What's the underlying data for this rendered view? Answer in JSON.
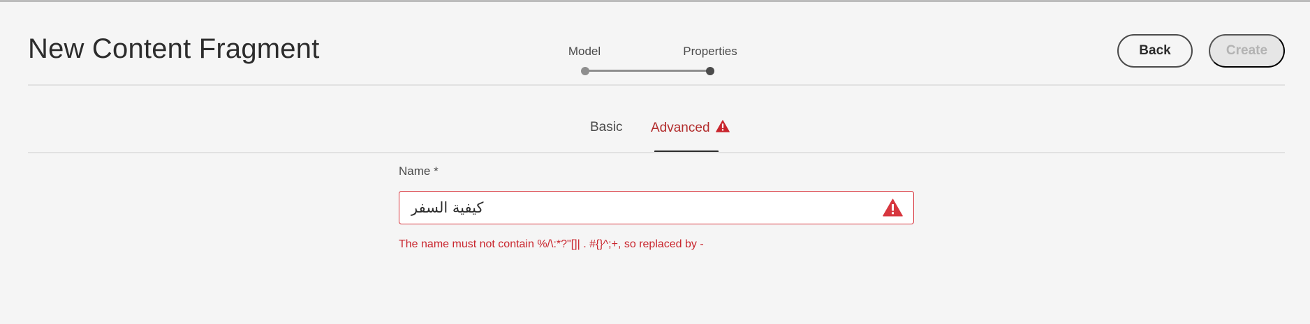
{
  "header": {
    "title": "New Content Fragment",
    "back_label": "Back",
    "create_label": "Create"
  },
  "stepper": {
    "steps": [
      {
        "label": "Model",
        "state": "completed"
      },
      {
        "label": "Properties",
        "state": "current"
      }
    ]
  },
  "tabs": [
    {
      "label": "Basic",
      "selected": false,
      "has_error": false
    },
    {
      "label": "Advanced",
      "selected": true,
      "has_error": true
    }
  ],
  "form": {
    "name_label": "Name *",
    "name_value": "كيفية السفر",
    "error_message": "The name must not contain %/\\:*?\"[]| . #{}^;+, so replaced by -"
  },
  "icons": {
    "tab_warning": "alert-triangle-icon",
    "field_warning": "alert-triangle-icon"
  },
  "colors": {
    "error": "#c9252d",
    "error_icon": "#d7373f",
    "background": "#f5f5f5"
  }
}
